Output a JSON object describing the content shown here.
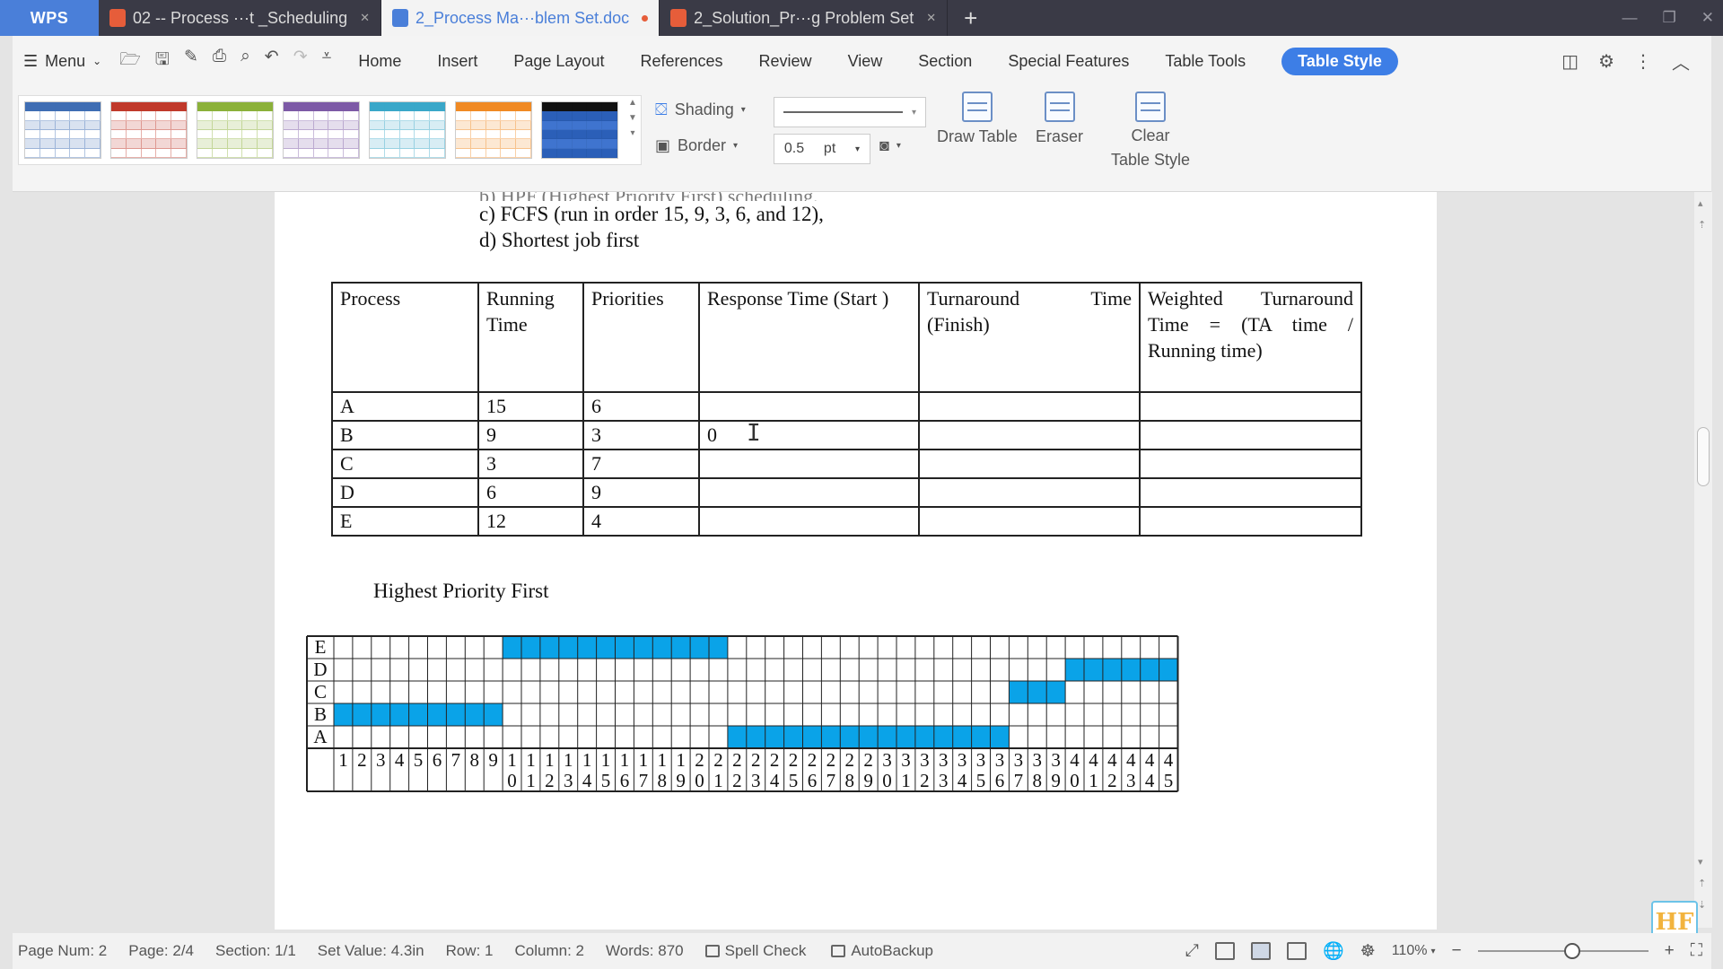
{
  "tabs": {
    "app_label": "WPS",
    "items": [
      {
        "label": "02 -- Process ···t _Scheduling",
        "color": "#e65d3a"
      },
      {
        "label": "2_Process Ma···blem Set.doc",
        "color": "#4a7fd9"
      },
      {
        "label": "2_Solution_Pr···g Problem Set",
        "color": "#e65d3a"
      }
    ],
    "add_label": "+"
  },
  "menubar": {
    "menu_label": "Menu",
    "items": [
      "Home",
      "Insert",
      "Page Layout",
      "References",
      "Review",
      "View",
      "Section",
      "Special Features",
      "Table Tools"
    ],
    "active_item": "Table Style"
  },
  "ribbon": {
    "swatch_colors": [
      "#3f6db3",
      "#c0392b",
      "#8bb13a",
      "#7d5aa6",
      "#3aa7c9",
      "#f08a24",
      "#1f1f1f"
    ],
    "shading_label": "Shading",
    "border_label": "Border",
    "line_width": "0.5",
    "line_unit": "pt",
    "draw_table_label": "Draw Table",
    "eraser_label": "Eraser",
    "clear_style_label": "Clear\nTable Style"
  },
  "document": {
    "partial_line": "b)   HPF (Highest Priority First) scheduling,",
    "item_c": "c)  FCFS (run in order 15, 9, 3, 6, and 12),",
    "item_d": "d)  Shortest job first",
    "table": {
      "headers": [
        "Process",
        "Running Time",
        "Priorities",
        "Response Time (Start )",
        "Turnaround Time (Finish)",
        "Weighted Turnaround Time = (TA time / Running time)"
      ],
      "rows": [
        [
          "A",
          "15",
          "6",
          "",
          "",
          ""
        ],
        [
          "B",
          "9",
          "3",
          "0",
          "",
          ""
        ],
        [
          "C",
          "3",
          "7",
          "",
          "",
          ""
        ],
        [
          "D",
          "6",
          "9",
          "",
          "",
          ""
        ],
        [
          "E",
          "12",
          "4",
          "",
          "",
          ""
        ]
      ]
    },
    "gantt_title": "Highest Priority First",
    "gantt": {
      "row_labels": [
        "E",
        "D",
        "C",
        "B",
        "A"
      ],
      "bar_color": "#0aa3e8",
      "columns": 45,
      "bars": [
        {
          "process": "E",
          "start": 10,
          "end": 21
        },
        {
          "process": "D",
          "start": 40,
          "end": 45
        },
        {
          "process": "C",
          "start": 37,
          "end": 39
        },
        {
          "process": "B",
          "start": 1,
          "end": 9
        },
        {
          "process": "A",
          "start": 22,
          "end": 36
        }
      ]
    }
  },
  "statusbar": {
    "page_num": "Page Num: 2",
    "page": "Page: 2/4",
    "section": "Section: 1/1",
    "set_value": "Set Value: 4.3in",
    "row": "Row: 1",
    "column": "Column: 2",
    "words": "Words: 870",
    "spell_check": "Spell Check",
    "autobackup": "AutoBackup",
    "zoom": "110%"
  },
  "watermark": "HF"
}
